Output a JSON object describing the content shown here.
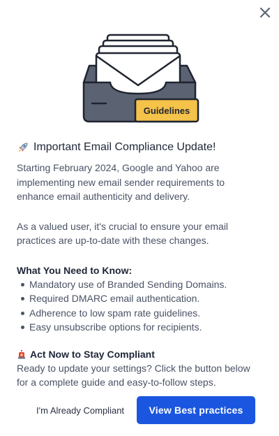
{
  "dialog": {
    "close_icon": "close-icon",
    "illustration": {
      "badge_label": "Guidelines",
      "colors": {
        "tray": "#5b6272",
        "envelope": "#ffffff",
        "outline": "#1f2430",
        "badge": "#f5c24a"
      }
    },
    "title": "Important Email Compliance Update!",
    "title_icon": "rocket-icon",
    "intro": "Starting February 2024, Google and Yahoo are implementing new email sender requirements to enhance email authenticity and delivery.",
    "valued_user": "As a valued user, it's crucial to ensure your email practices are up-to-date with these changes.",
    "needs_heading": "What You Need to Know:",
    "needs": [
      "Mandatory use of Branded Sending Domains.",
      "Required DMARC email authentication.",
      "Adherence to low spam rate guidelines.",
      "Easy unsubscribe options for recipients."
    ],
    "act_heading": "Act Now to Stay Compliant",
    "act_icon": "alarm-icon",
    "act_text": "Ready to update your settings? Click the button below for a complete guide and easy-to-follow steps.",
    "secondary_button": "I'm Already Compliant",
    "primary_button": "View Best practices",
    "accent_color": "#1a56e0"
  }
}
